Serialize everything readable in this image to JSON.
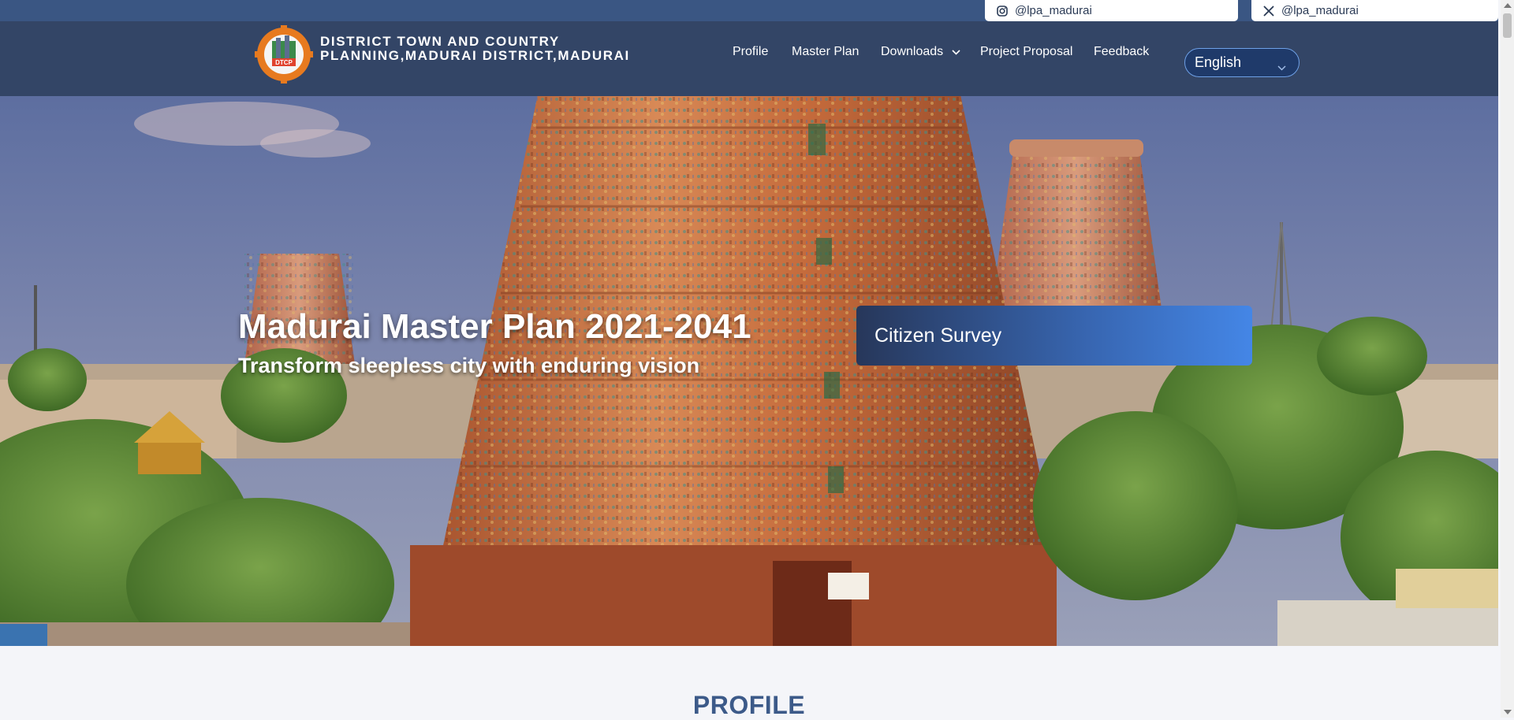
{
  "social": {
    "instagram": {
      "handle": "@lpa_madurai",
      "icon": "instagram-icon"
    },
    "x": {
      "handle": "@lpa_madurai",
      "icon": "x-icon"
    }
  },
  "header": {
    "org_name": "DISTRICT TOWN AND COUNTRY\nPLANNING,MADURAI DISTRICT,MADURAI",
    "logo_text": "DTCP",
    "nav": [
      {
        "label": "Profile"
      },
      {
        "label": "Master Plan"
      },
      {
        "label": "Downloads",
        "has_dropdown": true
      },
      {
        "label": "Project Proposal"
      },
      {
        "label": "Feedback"
      }
    ],
    "language": {
      "selected": "English"
    }
  },
  "hero": {
    "title": "Madurai Master Plan 2021-2041",
    "subtitle": "Transform sleepless city with enduring vision",
    "survey_label": "Citizen Survey"
  },
  "profile": {
    "heading": "PROFILE"
  },
  "colors": {
    "topbar": "#3a5683",
    "header": "#23375a",
    "accent": "#4486e6",
    "heading": "#3c5a89"
  }
}
